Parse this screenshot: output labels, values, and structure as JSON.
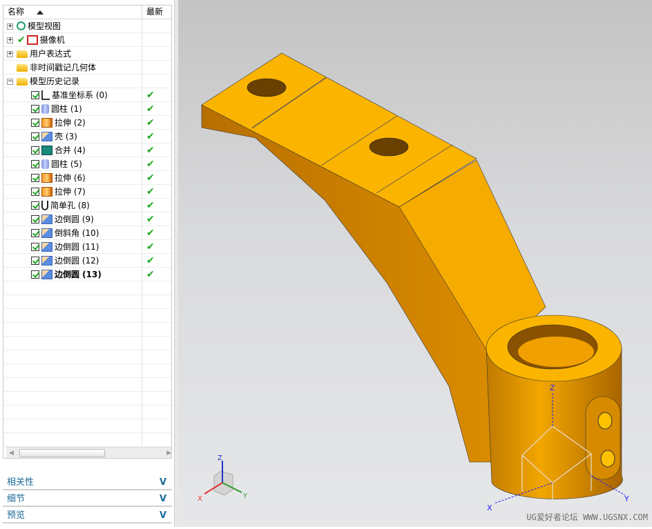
{
  "tree": {
    "columns": {
      "name": "名称",
      "latest": "最新"
    },
    "top_nodes": [
      {
        "label": "模型视图",
        "icon": "model-view-icon",
        "expander": "+"
      },
      {
        "label": "摄像机",
        "icon": "camera-icon",
        "expander": "+"
      },
      {
        "label": "用户表达式",
        "icon": "folder-icon",
        "expander": "+"
      },
      {
        "label": "非时间戳记几何体",
        "icon": "folder-icon",
        "expander": ""
      },
      {
        "label": "模型历史记录",
        "icon": "folder-open-icon",
        "expander": "−"
      }
    ],
    "features": [
      {
        "label": "基准坐标系 (0)",
        "icon": "datum-csys-icon",
        "bold": false
      },
      {
        "label": "圆柱 (1)",
        "icon": "cylinder-icon",
        "bold": false
      },
      {
        "label": "拉伸 (2)",
        "icon": "extrude-icon",
        "bold": false
      },
      {
        "label": "壳 (3)",
        "icon": "shell-icon",
        "bold": false
      },
      {
        "label": "合并 (4)",
        "icon": "unite-icon",
        "bold": false
      },
      {
        "label": "圆柱 (5)",
        "icon": "cylinder-icon",
        "bold": false
      },
      {
        "label": "拉伸 (6)",
        "icon": "extrude-icon",
        "bold": false
      },
      {
        "label": "拉伸 (7)",
        "icon": "extrude-icon",
        "bold": false
      },
      {
        "label": "简单孔 (8)",
        "icon": "hole-icon",
        "bold": false
      },
      {
        "label": "边倒圆 (9)",
        "icon": "edge-blend-icon",
        "bold": false
      },
      {
        "label": "倒斜角 (10)",
        "icon": "chamfer-icon",
        "bold": false
      },
      {
        "label": "边倒圆 (11)",
        "icon": "edge-blend-icon",
        "bold": false
      },
      {
        "label": "边倒圆 (12)",
        "icon": "edge-blend-icon",
        "bold": false
      },
      {
        "label": "边倒圆 (13)",
        "icon": "edge-blend-icon",
        "bold": true
      }
    ],
    "check_mark": "✔"
  },
  "panels": [
    {
      "label": "相关性"
    },
    {
      "label": "细节"
    },
    {
      "label": "预览"
    }
  ],
  "chevron": "V",
  "viewport": {
    "triad": {
      "x": "X",
      "y": "Y",
      "z": "Z"
    },
    "watermark": "UG爱好者论坛 WWW.UGSNX.COM",
    "part_color": "#f5a800"
  }
}
